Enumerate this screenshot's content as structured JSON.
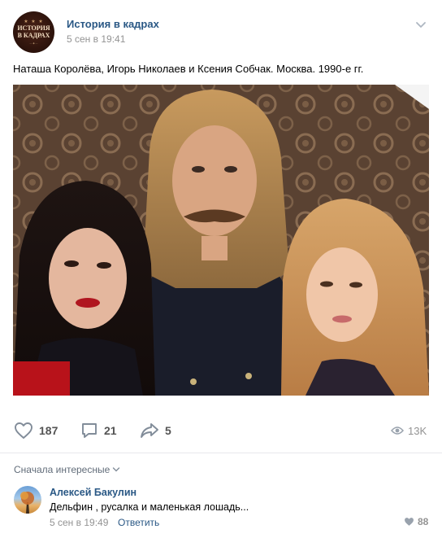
{
  "post": {
    "group_name": "История в кадрах",
    "date": "5 сен в 19:41",
    "avatar_logo": "ИСТОРИЯ В КАДРАХ",
    "text": "Наташа Королёва, Игорь Николаев и Ксения Собчак. Москва. 1990-е гг.",
    "photo_icon": "photo-of-three-people"
  },
  "actions": {
    "likes": "187",
    "comments": "21",
    "shares": "5",
    "views": "13K"
  },
  "comments": {
    "sort_label": "Сначала интересные",
    "items": [
      {
        "author": "Алексей Бакулин",
        "text": "Дельфин , русалка и маленькая лошадь...",
        "date": "5 сен в 19:49",
        "reply_label": "Ответить",
        "likes": "88"
      }
    ]
  },
  "colors": {
    "link": "#2a5885",
    "muted": "#939393",
    "icon": "#545454"
  }
}
